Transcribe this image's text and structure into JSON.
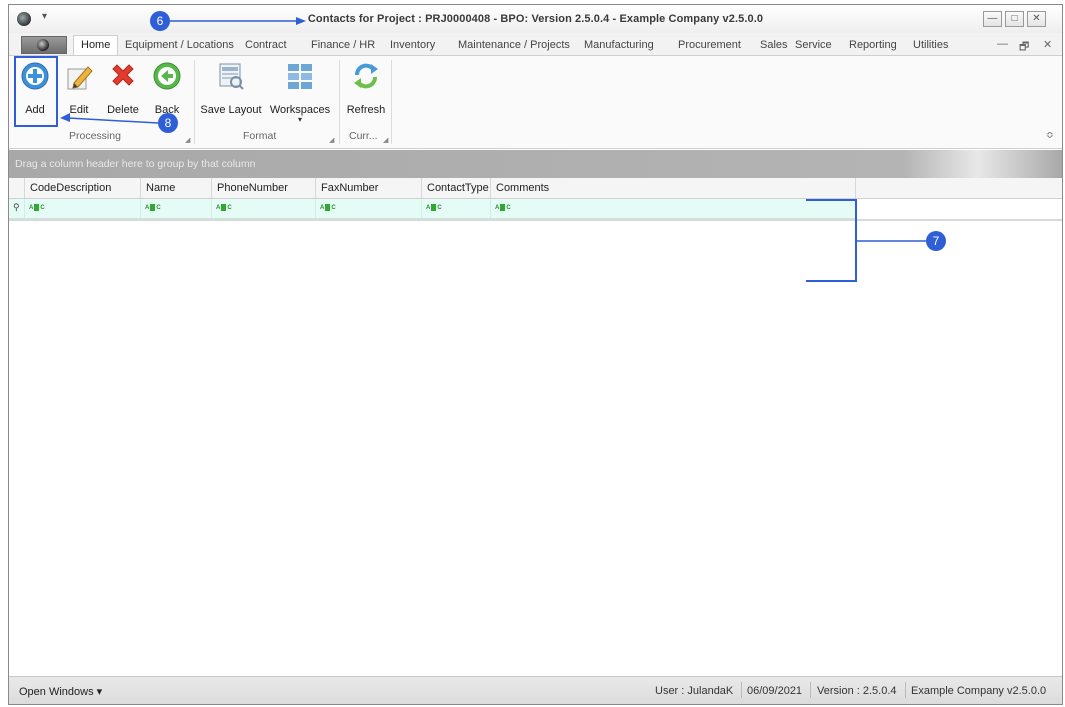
{
  "window": {
    "title": "Contacts for Project : PRJ0000408 - BPO: Version 2.5.0.4 - Example Company v2.5.0.0",
    "min_glyph": "—",
    "max_glyph": "□",
    "close_glyph": "✕",
    "qat_glyph": "▾"
  },
  "tabs": [
    "Home",
    "Equipment / Locations",
    "Contract",
    "Finance / HR",
    "Inventory",
    "Maintenance / Projects",
    "Manufacturing",
    "Procurement",
    "Sales",
    "Service",
    "Reporting",
    "Utilities"
  ],
  "mdi_controls": [
    "—",
    "🗗",
    "✕"
  ],
  "ribbon": {
    "processing": {
      "label": "Processing",
      "buttons": [
        "Add",
        "Edit",
        "Delete",
        "Back"
      ]
    },
    "format": {
      "label": "Format",
      "buttons": [
        "Save Layout",
        "Workspaces"
      ]
    },
    "current": {
      "label": "Curr...",
      "buttons": [
        "Refresh"
      ]
    },
    "workspaces_arrow": "▾",
    "collapse_glyph": "≎"
  },
  "grid": {
    "group_panel_text": "Drag a column header here to group by that column",
    "columns": [
      "CodeDescription",
      "Name",
      "PhoneNumber",
      "FaxNumber",
      "ContactType",
      "Comments"
    ],
    "filter_pin": "⚲"
  },
  "status_bar": {
    "open_windows": "Open Windows ▾",
    "user": "User : JulandaK",
    "date": "06/09/2021",
    "version": "Version : 2.5.0.4",
    "company": "Example Company v2.5.0.0"
  },
  "annotations": {
    "six": "6",
    "seven": "7",
    "eight": "8"
  },
  "colors": {
    "annotation": "#2f5fd6",
    "filter_row": "#e4fbf6",
    "delete_red": "#e23b2e",
    "back_green": "#56b848",
    "add_blue": "#3d8fd9"
  }
}
